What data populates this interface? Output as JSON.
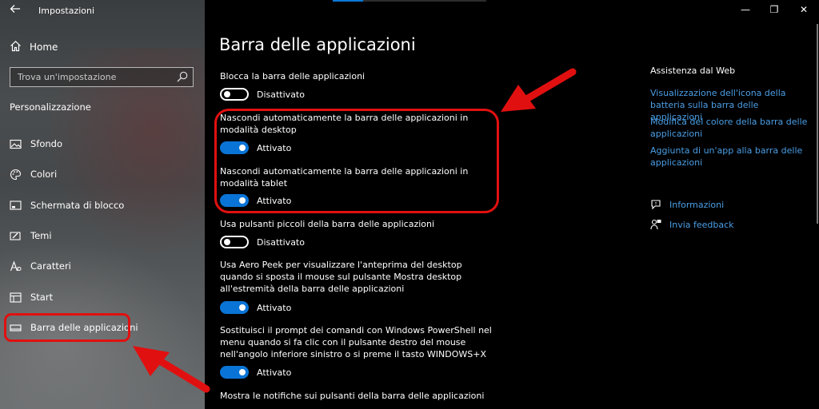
{
  "window": {
    "title": "Impostazioni",
    "back_icon": "back-arrow-icon",
    "minimize_glyph": "—",
    "maximize_glyph": "❐",
    "close_glyph": "✕"
  },
  "sidebar": {
    "home_label": "Home",
    "search_placeholder": "Trova un'impostazione",
    "section_label": "Personalizzazione",
    "items": [
      {
        "label": "Sfondo",
        "icon": "image-icon"
      },
      {
        "label": "Colori",
        "icon": "palette-icon"
      },
      {
        "label": "Schermata di blocco",
        "icon": "lock-screen-icon"
      },
      {
        "label": "Temi",
        "icon": "brush-icon"
      },
      {
        "label": "Caratteri",
        "icon": "font-icon"
      },
      {
        "label": "Start",
        "icon": "start-icon"
      },
      {
        "label": "Barra delle applicazioni",
        "icon": "taskbar-icon",
        "selected": true
      }
    ]
  },
  "main": {
    "title": "Barra delle applicazioni",
    "settings": [
      {
        "label": "Blocca la barra delle applicazioni",
        "state": "Disattivato",
        "on": false
      },
      {
        "label": "Nascondi automaticamente la barra delle applicazioni in modalità desktop",
        "state": "Attivato",
        "on": true
      },
      {
        "label": "Nascondi automaticamente la barra delle applicazioni in modalità tablet",
        "state": "Attivato",
        "on": true
      },
      {
        "label": "Usa pulsanti piccoli della barra delle applicazioni",
        "state": "Disattivato",
        "on": false
      },
      {
        "label": "Usa Aero Peek per visualizzare l'anteprima del desktop quando si sposta il mouse sul pulsante Mostra desktop all'estremità della barra delle applicazioni",
        "state": "Attivato",
        "on": true
      },
      {
        "label": "Sostituisci il prompt dei comandi con Windows PowerShell nel menu quando si fa clic con il pulsante destro del mouse nell'angolo inferiore sinistro o si preme il tasto WINDOWS+X",
        "state": "Attivato",
        "on": true
      },
      {
        "label": "Mostra le notifiche sui pulsanti della barra delle applicazioni"
      }
    ]
  },
  "help": {
    "heading": "Assistenza dal Web",
    "links": [
      "Visualizzazione dell'icona della batteria sulla barra delle applicazioni",
      "Modifica del colore della barra delle applicazioni",
      "Aggiunta di un'app alla barra delle applicazioni"
    ],
    "info_label": "Informazioni",
    "feedback_label": "Invia feedback"
  },
  "colors": {
    "accent": "#0a74d6",
    "link": "#4b9ee6",
    "highlight": "#e11010"
  }
}
